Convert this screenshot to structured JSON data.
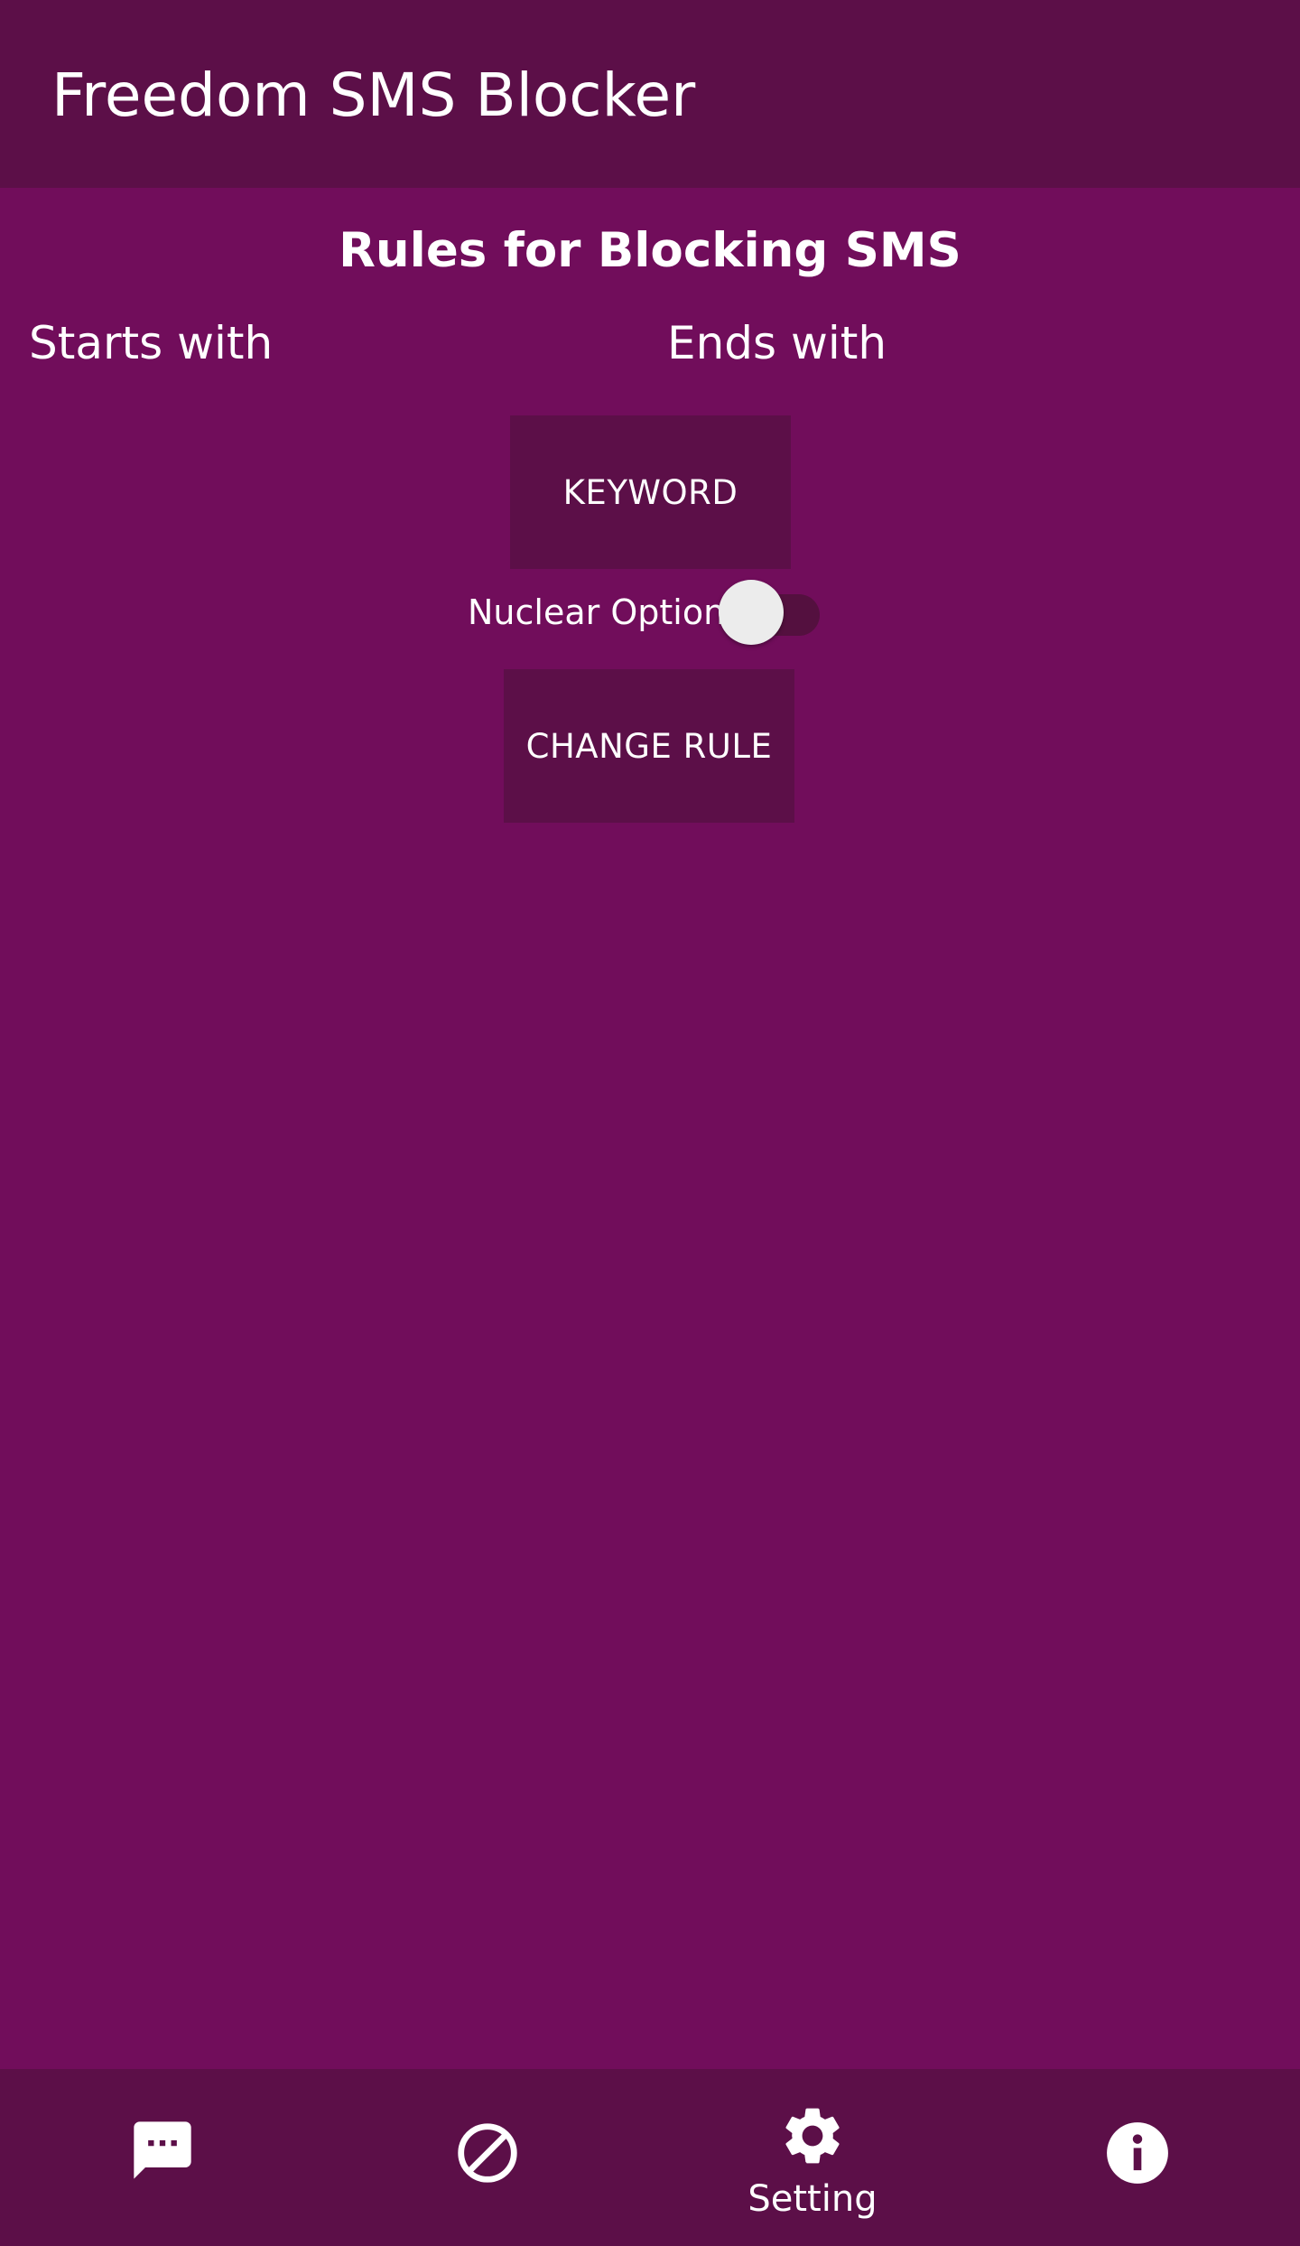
{
  "app": {
    "title": "Freedom SMS Blocker"
  },
  "rules": {
    "title": "Rules for Blocking SMS",
    "starts_with_label": "Starts with",
    "ends_with_label": "Ends with",
    "keyword_button": "KEYWORD",
    "nuclear_option_label": "Nuclear Option",
    "nuclear_option_enabled": false,
    "change_rule_button": "CHANGE RULE"
  },
  "bottom_nav": {
    "items": [
      {
        "icon": "message-icon",
        "label": "",
        "selected": false
      },
      {
        "icon": "block-icon",
        "label": "",
        "selected": false
      },
      {
        "icon": "gear-icon",
        "label": "Setting",
        "selected": true
      },
      {
        "icon": "info-icon",
        "label": "",
        "selected": false
      }
    ]
  },
  "colors": {
    "background": "#710d5b",
    "app_bar": "#5c0f48",
    "button": "#5c0f48",
    "text": "#ffffff"
  }
}
